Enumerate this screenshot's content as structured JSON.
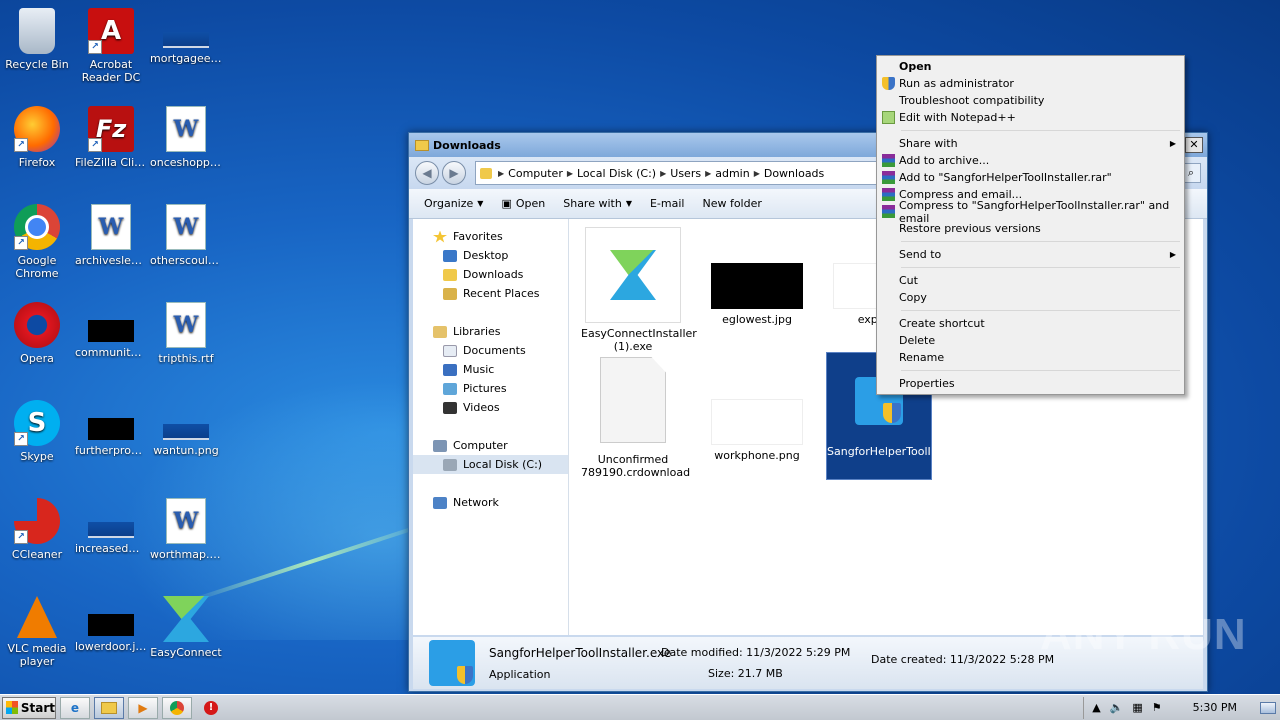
{
  "desktop": {
    "icons": [
      {
        "label": "Recycle Bin",
        "icon": "recycle-bin-icon"
      },
      {
        "label": "Acrobat Reader DC",
        "icon": "acrobat-icon"
      },
      {
        "label": "mortgagee....",
        "icon": "file-icon"
      },
      {
        "label": "Firefox",
        "icon": "firefox-icon"
      },
      {
        "label": "FileZilla Client",
        "icon": "filezilla-icon"
      },
      {
        "label": "onceshoppi...",
        "icon": "word-doc-icon"
      },
      {
        "label": "Google Chrome",
        "icon": "chrome-icon"
      },
      {
        "label": "archiveslea...",
        "icon": "word-doc-icon"
      },
      {
        "label": "otherscould...",
        "icon": "word-doc-icon"
      },
      {
        "label": "Opera",
        "icon": "opera-icon"
      },
      {
        "label": "communityd...",
        "icon": "image-icon"
      },
      {
        "label": "tripthis.rtf",
        "icon": "word-doc-icon"
      },
      {
        "label": "Skype",
        "icon": "skype-icon"
      },
      {
        "label": "furtherprovi...",
        "icon": "image-icon"
      },
      {
        "label": "wantun.png",
        "icon": "image-icon"
      },
      {
        "label": "CCleaner",
        "icon": "ccleaner-icon"
      },
      {
        "label": "increasedm...",
        "icon": "image-icon"
      },
      {
        "label": "worthmap.rtf",
        "icon": "word-doc-icon"
      },
      {
        "label": "VLC media player",
        "icon": "vlc-icon"
      },
      {
        "label": "lowerdoor.jpg",
        "icon": "image-icon"
      },
      {
        "label": "EasyConnect",
        "icon": "easyconnect-icon"
      }
    ]
  },
  "explorer": {
    "title": "Downloads",
    "breadcrumbs": [
      "Computer",
      "Local Disk (C:)",
      "Users",
      "admin",
      "Downloads"
    ],
    "toolbar": {
      "organize": "Organize",
      "open": "Open",
      "share_with": "Share with",
      "email": "E-mail",
      "new_folder": "New folder"
    },
    "nav": {
      "favorites": "Favorites",
      "desktop": "Desktop",
      "downloads": "Downloads",
      "recent_places": "Recent Places",
      "libraries": "Libraries",
      "documents": "Documents",
      "music": "Music",
      "pictures": "Pictures",
      "videos": "Videos",
      "computer": "Computer",
      "local_disk": "Local Disk (C:)",
      "network": "Network"
    },
    "files": [
      {
        "name": "EasyConnectInstaller (1).exe"
      },
      {
        "name": "eglowest.jpg"
      },
      {
        "name": "express"
      },
      {
        "name": "Unconfirmed 789190.crdownload"
      },
      {
        "name": "workphone.png"
      },
      {
        "name": "SangforHelperToolInstaller.exe"
      }
    ],
    "status": {
      "filename": "SangforHelperToolInstaller.exe",
      "type": "Application",
      "date_modified": "Date modified: 11/3/2022 5:29 PM",
      "size": "Size: 21.7 MB",
      "date_created": "Date created: 11/3/2022 5:28 PM"
    }
  },
  "context_menu": {
    "open": "Open",
    "run_as_admin": "Run as administrator",
    "troubleshoot": "Troubleshoot compatibility",
    "edit_notepad": "Edit with Notepad++",
    "share_with": "Share with",
    "add_archive": "Add to archive...",
    "add_to_rar": "Add to \"SangforHelperToolInstaller.rar\"",
    "compress_email": "Compress and email...",
    "compress_rar_email": "Compress to \"SangforHelperToolInstaller.rar\" and email",
    "restore": "Restore previous versions",
    "send_to": "Send to",
    "cut": "Cut",
    "copy": "Copy",
    "create_shortcut": "Create shortcut",
    "delete": "Delete",
    "rename": "Rename",
    "properties": "Properties"
  },
  "taskbar": {
    "start": "Start",
    "clock": "5:30 PM"
  },
  "watermark": "ANY RUN"
}
